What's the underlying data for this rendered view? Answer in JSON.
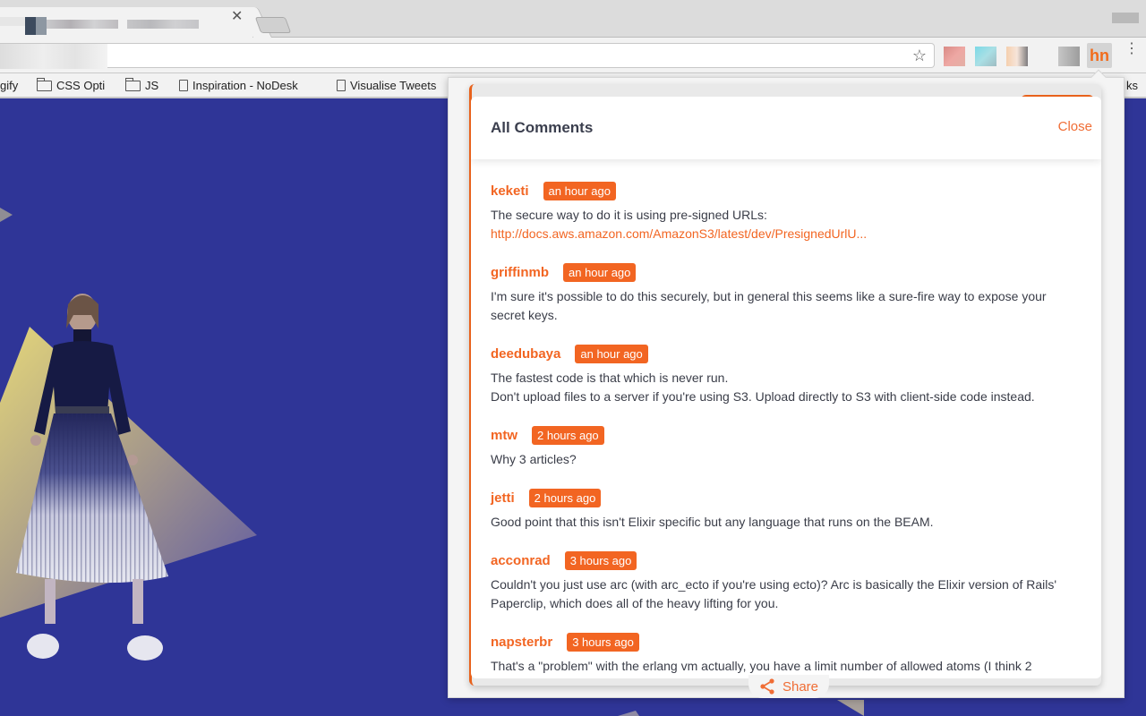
{
  "browser": {
    "tab": {
      "close_glyph": "✕"
    },
    "toolbar": {
      "star_glyph": "☆",
      "extension_badge": "hn",
      "menu_glyph": "⋮"
    },
    "bookmarks": [
      {
        "label": "gify",
        "icon": "none"
      },
      {
        "label": "CSS Opti",
        "icon": "folder-icon"
      },
      {
        "label": "JS",
        "icon": "folder-icon"
      },
      {
        "label": "Inspiration - NoDesk",
        "icon": "page-icon"
      },
      {
        "label": "Visualise Tweets",
        "icon": "page-icon"
      },
      {
        "label": "ks",
        "icon": "none"
      }
    ]
  },
  "panel": {
    "title": "All Comments",
    "close_label": "Close",
    "share_label": "Share",
    "accent_color": "#f26522",
    "comments": [
      {
        "user": "keketi",
        "time": "an hour ago",
        "lines": [
          "The secure way to do it is using pre-signed URLs:"
        ],
        "link": "http://docs.aws.amazon.com/AmazonS3/latest/dev/PresignedUrlU..."
      },
      {
        "user": "griffinmb",
        "time": "an hour ago",
        "lines": [
          "I'm sure it's possible to do this securely, but in general this seems like a sure-fire way to expose your",
          "secret keys."
        ]
      },
      {
        "user": "deedubaya",
        "time": "an hour ago",
        "lines": [
          "The fastest code is that which is never run.",
          "Don't upload files to a server if you're using S3. Upload directly to S3 with client-side code instead."
        ]
      },
      {
        "user": "mtw",
        "time": "2 hours ago",
        "lines": [
          "Why 3 articles?"
        ]
      },
      {
        "user": "jetti",
        "time": "2 hours ago",
        "lines": [
          "Good point that this isn't Elixir specific but any language that runs on the BEAM."
        ]
      },
      {
        "user": "acconrad",
        "time": "3 hours ago",
        "lines": [
          "Couldn't you just use arc (with arc_ecto if you're using ecto)? Arc is basically the Elixir version of Rails'",
          "Paperclip, which does all of the heavy lifting for you."
        ]
      },
      {
        "user": "napsterbr",
        "time": "3 hours ago",
        "lines": [
          "That's a \"problem\" with the erlang vm actually, you have a limit number of allowed atoms (I think 2"
        ]
      }
    ]
  }
}
